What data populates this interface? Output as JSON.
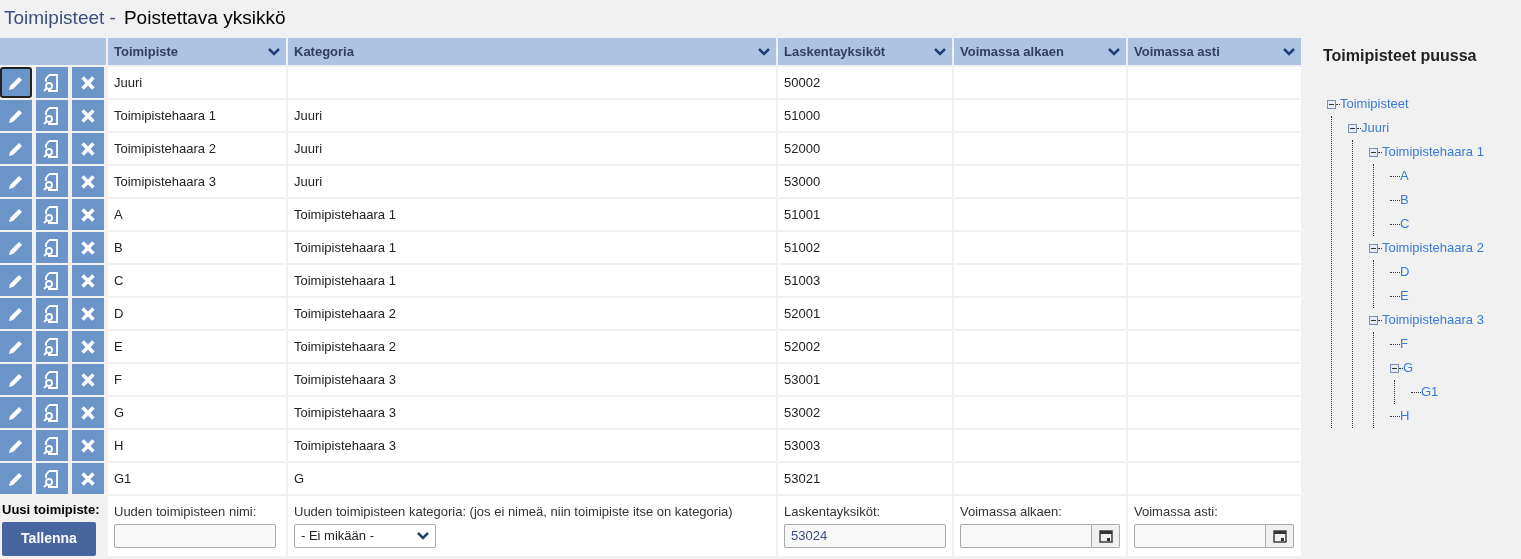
{
  "heading": {
    "section": "Toimipisteet -",
    "title": "Poistettava yksikkö"
  },
  "table": {
    "columns": [
      "Toimipiste",
      "Kategoria",
      "Laskentayksiköt",
      "Voimassa alkaen",
      "Voimassa asti"
    ],
    "rows": [
      {
        "cells": [
          "Juuri",
          "",
          "50002",
          "",
          ""
        ],
        "focused": true
      },
      {
        "cells": [
          "Toimipistehaara 1",
          "Juuri",
          "51000",
          "",
          ""
        ],
        "focused": false
      },
      {
        "cells": [
          "Toimipistehaara 2",
          "Juuri",
          "52000",
          "",
          ""
        ],
        "focused": false
      },
      {
        "cells": [
          "Toimipistehaara 3",
          "Juuri",
          "53000",
          "",
          ""
        ],
        "focused": false
      },
      {
        "cells": [
          "A",
          "Toimipistehaara 1",
          "51001",
          "",
          ""
        ],
        "focused": false
      },
      {
        "cells": [
          "B",
          "Toimipistehaara 1",
          "51002",
          "",
          ""
        ],
        "focused": false
      },
      {
        "cells": [
          "C",
          "Toimipistehaara 1",
          "51003",
          "",
          ""
        ],
        "focused": false
      },
      {
        "cells": [
          "D",
          "Toimipistehaara 2",
          "52001",
          "",
          ""
        ],
        "focused": false
      },
      {
        "cells": [
          "E",
          "Toimipistehaara 2",
          "52002",
          "",
          ""
        ],
        "focused": false
      },
      {
        "cells": [
          "F",
          "Toimipistehaara 3",
          "53001",
          "",
          ""
        ],
        "focused": false
      },
      {
        "cells": [
          "G",
          "Toimipistehaara 3",
          "53002",
          "",
          ""
        ],
        "focused": false
      },
      {
        "cells": [
          "H",
          "Toimipistehaara 3",
          "53003",
          "",
          ""
        ],
        "focused": false
      },
      {
        "cells": [
          "G1",
          "G",
          "53021",
          "",
          ""
        ],
        "focused": false
      }
    ],
    "new_row": {
      "label": "Uusi toimipiste:",
      "save_button": "Tallenna",
      "fields": [
        {
          "kind": "text",
          "label": "Uuden toimipisteen nimi:"
        },
        {
          "kind": "select",
          "label": "Uuden toimipisteen kategoria: (jos ei nimeä, niin toimipiste itse on kategoria)",
          "value": "- Ei mikään -"
        },
        {
          "kind": "text",
          "label": "Laskentayksiköt:",
          "value": "53024"
        },
        {
          "kind": "date",
          "label": "Voimassa alkaen:"
        },
        {
          "kind": "date",
          "label": "Voimassa asti:"
        }
      ]
    }
  },
  "tree": {
    "title": "Toimipisteet puussa",
    "items": [
      {
        "label": "Toimipisteet",
        "expanded": true,
        "children": [
          {
            "label": "Juuri",
            "expanded": true,
            "children": [
              {
                "label": "Toimipistehaara 1",
                "expanded": true,
                "children": [
                  {
                    "label": "A"
                  },
                  {
                    "label": "B"
                  },
                  {
                    "label": "C"
                  }
                ]
              },
              {
                "label": "Toimipistehaara 2",
                "expanded": true,
                "children": [
                  {
                    "label": "D"
                  },
                  {
                    "label": "E"
                  }
                ]
              },
              {
                "label": "Toimipistehaara 3",
                "expanded": true,
                "children": [
                  {
                    "label": "F"
                  },
                  {
                    "label": "G",
                    "expanded": true,
                    "children": [
                      {
                        "label": "G1"
                      }
                    ]
                  },
                  {
                    "label": "H"
                  }
                ]
              }
            ]
          }
        ]
      }
    ]
  }
}
